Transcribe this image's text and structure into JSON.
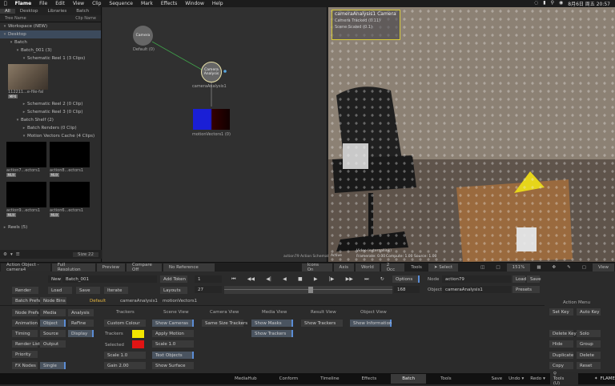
{
  "menubar": {
    "app": "Flame",
    "items": [
      "File",
      "Edit",
      "View",
      "Clip",
      "Sequence",
      "Mark",
      "Effects",
      "Window",
      "Help"
    ],
    "datetime": "8月6日 周五 20:57"
  },
  "library": {
    "tabs": [
      "All",
      "Desktop",
      "Libraries",
      "Batch"
    ],
    "header_left": "Tree Name",
    "header_right": "Clip Name",
    "rows": [
      {
        "label": "Workspace (NEW)",
        "indent": 0
      },
      {
        "label": "Desktop",
        "indent": 1
      },
      {
        "label": "Batch",
        "indent": 2
      },
      {
        "label": "Batch_001 (3)",
        "indent": 3
      },
      {
        "label": "Schematic Reel 1 (3 Clips)",
        "indent": 4
      }
    ],
    "rows2": [
      {
        "label": "Schematic Reel 2 (0 Clip)"
      },
      {
        "label": "Schematic Reel 3 (0 Clip)"
      },
      {
        "label": "Batch Shelf (2)"
      },
      {
        "label": "Batch Renders (0 Clip)"
      },
      {
        "label": "Motion Vectors Cache (4 Clips)"
      }
    ],
    "first_clip": {
      "caption": "112211...e-file-fal",
      "tag": "MP4"
    },
    "thumbs": [
      {
        "caption": "action7...ectors1",
        "tag": "MUX"
      },
      {
        "caption": "action8...ectors1",
        "tag": "MUX"
      },
      {
        "caption": "action9...ectors1",
        "tag": "MUX"
      },
      {
        "caption": "action6...ectors1",
        "tag": "MUX"
      }
    ],
    "reels": "Reels (5)",
    "size": "Size 22"
  },
  "schematic": {
    "camera_node": "Camera",
    "camera_label": "Default (0)",
    "analysis_node": "Camera Analysis",
    "analysis_label": "cameraAnalysis1",
    "mv_label": "motionVectors1 (0)",
    "footer": "action79 Action Schematic"
  },
  "viewer": {
    "overlay_title": "cameraAnalysis1 Camera",
    "overlay_lines": [
      "Camera Tracked (0.11)",
      "Scene Scaled (0.1)"
    ],
    "status": [
      "Video (externallink)",
      "Framerate: 0.00",
      "Compute: 1.00",
      "Source: 1.00"
    ],
    "active": "Active"
  },
  "toolbar": {
    "action_object": "Action Object - camera4",
    "full_res": "Full Resolution",
    "preview": "Preview",
    "compare": "Compare Off",
    "no_ref": "No Reference",
    "icons_on": "Icons On",
    "axis": "Axis",
    "world": "World",
    "view2": "2 Occ",
    "tools": "Tools",
    "select": "Select",
    "zoom": "151%",
    "view": "View"
  },
  "bottom": {
    "new": "New",
    "batch_name": "Batch_001",
    "add_token": "Add Token",
    "frame": "1",
    "options": "Options",
    "node_label": "Node",
    "node_value": "action79",
    "load": "Load",
    "save": "Save",
    "object_label": "Object",
    "object_value": "cameraAnalysis1",
    "presets": "Presets",
    "render": "Render",
    "load2": "Load",
    "save2": "Save",
    "iterate": "Iterate",
    "layouts": "Layouts",
    "start": "27",
    "end": "168",
    "batch_prefs": "Batch Prefs",
    "node_bins": "Node Bins",
    "tabs": [
      "Default",
      "cameraAnalysis1",
      "motionVectors1"
    ],
    "left_grid": [
      [
        "Node Prefs",
        "Media",
        "Analysis"
      ],
      [
        "Animation",
        "Object",
        "ReFine"
      ],
      [
        "Timing",
        "Source",
        "Display"
      ],
      [
        "Render List",
        "Output",
        ""
      ],
      [
        "Priority",
        "",
        ""
      ],
      [
        "FX Nodes",
        "Single",
        ""
      ]
    ],
    "col_trackers": "Trackers",
    "custom_colour": "Custom Colour",
    "trackers": "Trackers",
    "selected": "Selected",
    "scale": "Scale 1.0",
    "gain": "Gain 2.00",
    "tracker_color": "#f2e600",
    "selected_color": "#e01414",
    "col_scene": "Scene View",
    "show_cameras": "Show Cameras",
    "apply_motion": "Apply Motion",
    "scale2": "Scale 1.0",
    "text_objects": "Text Objects",
    "show_surface": "Show Surface",
    "col_camera": "Camera View",
    "same_size": "Same Size Trackers",
    "col_media": "Media View",
    "show_masks": "Show Masks",
    "show_trackers": "Show Trackers",
    "col_result": "Result View",
    "show_trackers2": "Show Trackers",
    "col_object": "Object View",
    "show_info": "Show Information",
    "action_menu": "Action Menu",
    "set_key": "Set Key",
    "auto_key": "Auto Key",
    "delete_key": "Delete Key",
    "solo": "Solo",
    "hide": "Hide",
    "group": "Group",
    "duplicate": "Duplicate",
    "delete": "Delete",
    "copy": "Copy",
    "reset": "Reset"
  },
  "footer": {
    "tabs": [
      "MediaHub",
      "Conform",
      "Timeline",
      "Effects",
      "Batch",
      "Tools"
    ],
    "active": "Batch",
    "save": "Save",
    "undo": "Undo",
    "redo": "Redo",
    "tools_search": "Tools (U)",
    "brand": "FLAME"
  }
}
